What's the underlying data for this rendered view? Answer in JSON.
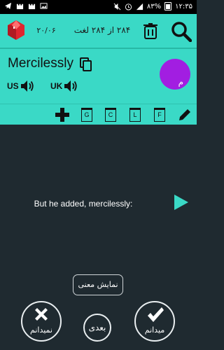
{
  "status": {
    "percent": "۸۳%",
    "time": "۱۲:۳۵"
  },
  "toolbar": {
    "counter": "۲۰/۰۶",
    "progress": "۲۸۴ از ۲۸۴ لغت"
  },
  "word": {
    "text": "Mercilessly",
    "avatar_letter": "م",
    "us_label": "US",
    "uk_label": "UK"
  },
  "tools": {
    "boxes": [
      "G",
      "C",
      "L",
      "F"
    ]
  },
  "content": {
    "sentence": "But he added, mercilessly:",
    "show_meaning": "نمایش معنی"
  },
  "actions": {
    "dont_know": "نمیدانم",
    "next": "بعدی",
    "know": "میدانم"
  },
  "colors": {
    "accent": "#3ad9c6",
    "background": "#1f2a30",
    "avatar": "#a21ee1",
    "gem": "#e0262f"
  }
}
